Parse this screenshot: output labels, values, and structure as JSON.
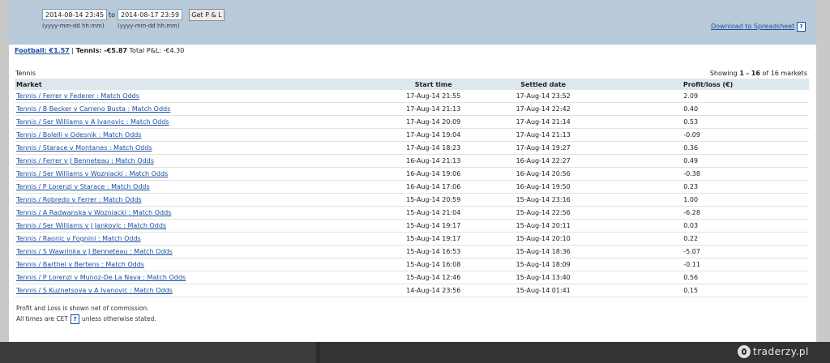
{
  "filter": {
    "from_value": "2014-08-14 23:45",
    "to_label": "to",
    "to_value": "2014-08-17 23:59",
    "format_hint": "(yyyy-mm-dd hh:mm)",
    "get_button_label": "Get P & L",
    "download_label": "Download to Spreadsheet",
    "help_label": "?"
  },
  "summary": {
    "football_link": "Football: €1.57",
    "separator": "|",
    "tennis_label": "Tennis: -€5.87",
    "total_label": "Total P&L:",
    "total_value": "-€4.30"
  },
  "section": {
    "title": "Tennis",
    "showing_prefix": "Showing",
    "showing_range": "1 - 16",
    "showing_of": "of 16 markets"
  },
  "table": {
    "headers": {
      "market": "Market",
      "start": "Start time",
      "settled": "Settled date",
      "pl": "Profit/loss (€)"
    },
    "rows": [
      {
        "market": "Tennis / Ferrer v Federer : Match Odds",
        "start": "17-Aug-14 21:55",
        "settled": "17-Aug-14 23:52",
        "pl": "2.09"
      },
      {
        "market": "Tennis / B Becker v Carreno Busta : Match Odds",
        "start": "17-Aug-14 21:13",
        "settled": "17-Aug-14 22:42",
        "pl": "0.40"
      },
      {
        "market": "Tennis / Ser Williams v A Ivanovic : Match Odds",
        "start": "17-Aug-14 20:09",
        "settled": "17-Aug-14 21:14",
        "pl": "0.53"
      },
      {
        "market": "Tennis / Bolelli v Odesnik : Match Odds",
        "start": "17-Aug-14 19:04",
        "settled": "17-Aug-14 21:13",
        "pl": "-0.09"
      },
      {
        "market": "Tennis / Starace v Montanes : Match Odds",
        "start": "17-Aug-14 18:23",
        "settled": "17-Aug-14 19:27",
        "pl": "0.36"
      },
      {
        "market": "Tennis / Ferrer v J Benneteau : Match Odds",
        "start": "16-Aug-14 21:13",
        "settled": "16-Aug-14 22:27",
        "pl": "0.49"
      },
      {
        "market": "Tennis / Ser Williams v Wozniacki : Match Odds",
        "start": "16-Aug-14 19:06",
        "settled": "16-Aug-14 20:56",
        "pl": "-0.38"
      },
      {
        "market": "Tennis / P Lorenzi v Starace : Match Odds",
        "start": "16-Aug-14 17:06",
        "settled": "16-Aug-14 19:50",
        "pl": "0.23"
      },
      {
        "market": "Tennis / Robredo v Ferrer : Match Odds",
        "start": "15-Aug-14 20:59",
        "settled": "15-Aug-14 23:16",
        "pl": "1.00"
      },
      {
        "market": "Tennis / A Radwanska v Wozniacki : Match Odds",
        "start": "15-Aug-14 21:04",
        "settled": "15-Aug-14 22:56",
        "pl": "-6.28"
      },
      {
        "market": "Tennis / Ser Williams v J Jankovic : Match Odds",
        "start": "15-Aug-14 19:17",
        "settled": "15-Aug-14 20:11",
        "pl": "0.03"
      },
      {
        "market": "Tennis / Raonic v Fognini : Match Odds",
        "start": "15-Aug-14 19:17",
        "settled": "15-Aug-14 20:10",
        "pl": "0.22"
      },
      {
        "market": "Tennis / S Wawrinka v J Benneteau : Match Odds",
        "start": "15-Aug-14 16:53",
        "settled": "15-Aug-14 18:36",
        "pl": "-5.07"
      },
      {
        "market": "Tennis / Barthel v Bertens : Match Odds",
        "start": "15-Aug-14 16:08",
        "settled": "15-Aug-14 18:09",
        "pl": "-0.11"
      },
      {
        "market": "Tennis / P Lorenzi v Munoz-De La Nava : Match Odds",
        "start": "15-Aug-14 12:46",
        "settled": "15-Aug-14 13:40",
        "pl": "0.56"
      },
      {
        "market": "Tennis / S Kuznetsova v A Ivanovic : Match Odds",
        "start": "14-Aug-14 23:56",
        "settled": "15-Aug-14 01:41",
        "pl": "0.15"
      }
    ]
  },
  "footnotes": {
    "line1": "Profit and Loss is shown net of commission.",
    "line2_a": "All times are CET",
    "line2_b": "unless otherwise stated."
  },
  "watermark": {
    "text": "traderzy.pl"
  }
}
